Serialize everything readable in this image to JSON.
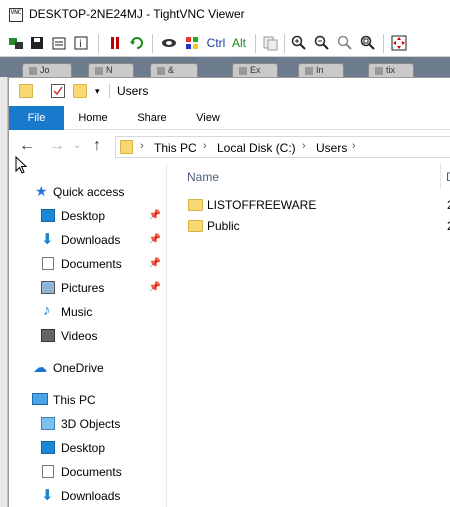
{
  "vnc": {
    "title": "DESKTOP-2NE24MJ - TightVNC Viewer",
    "logo_text": "VNC",
    "toolbar": {
      "ctrl_label": "Ctrl",
      "alt_label": "Alt"
    }
  },
  "remote_tabs": [
    "Jo",
    "N",
    "&",
    "Ex",
    "In",
    "tix"
  ],
  "explorer": {
    "title": "Users",
    "ribbon_tabs": [
      "File",
      "Home",
      "Share",
      "View"
    ],
    "breadcrumb": [
      "This PC",
      "Local Disk (C:)",
      "Users"
    ],
    "nav": {
      "quick_access": "Quick access",
      "quick_items": [
        "Desktop",
        "Downloads",
        "Documents",
        "Pictures",
        "Music",
        "Videos"
      ],
      "onedrive": "OneDrive",
      "this_pc": "This PC",
      "pc_items": [
        "3D Objects",
        "Desktop",
        "Documents",
        "Downloads"
      ]
    },
    "columns": {
      "name": "Name",
      "date": "D"
    },
    "files": [
      {
        "name": "LISTOFFREEWARE",
        "date": "2"
      },
      {
        "name": "Public",
        "date": "2"
      }
    ]
  },
  "colors": {
    "accent": "#1979ca",
    "folder": "#f8d775",
    "column_header": "#4c607a"
  }
}
